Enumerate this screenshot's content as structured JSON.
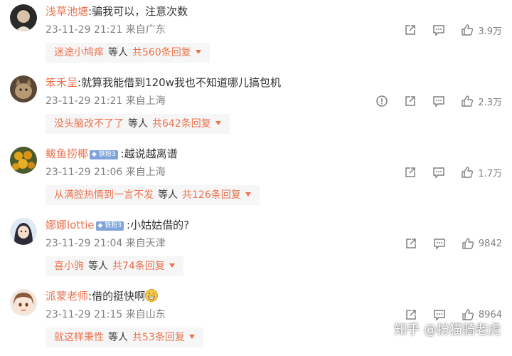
{
  "colors": {
    "accent": "#eb7350",
    "meta": "#808080",
    "text": "#333333",
    "reply_bg": "#f6f6f6",
    "badge": "#7fa4dc"
  },
  "comments": [
    {
      "user": "浅草池塘",
      "badge": "",
      "text": ":骗我可以，注意次数",
      "time": "23-11-29 21:21",
      "location": "来自广东",
      "likes": "3.9万",
      "has_report": false,
      "reply_user": "迷途小鸠痒",
      "reply_etc": "等人",
      "reply_total": "共560条回复"
    },
    {
      "user": "笨禾呈",
      "badge": "",
      "text": ":就算我能借到120w我也不知道哪儿搞包机",
      "time": "23-11-29 21:21",
      "location": "来自上海",
      "likes": "2.3万",
      "has_report": true,
      "reply_user": "没头脑改不了了",
      "reply_etc": "等人",
      "reply_total": "共642条回复"
    },
    {
      "user": "鲅鱼捞椰",
      "badge": "铁粉3",
      "text": ":越说越离谱",
      "time": "23-11-29 21:06",
      "location": "来自上海",
      "likes": "1.7万",
      "has_report": false,
      "reply_user": "从满腔热情到一言不发",
      "reply_etc": "等人",
      "reply_total": "共126条回复"
    },
    {
      "user": "娜娜lottie",
      "badge": "铁粉3",
      "text": ":小姑姑借的?",
      "time": "23-11-29 21:04",
      "location": "来自天津",
      "likes": "9842",
      "has_report": false,
      "reply_user": "喜小驹",
      "reply_etc": "等人",
      "reply_total": "共74条回复"
    },
    {
      "user": "派蒙老师",
      "badge": "",
      "text": ":借的挺快啊",
      "time": "23-11-29 21:15",
      "location": "来自山东",
      "likes": "8964",
      "has_report": false,
      "reply_user": "就这样秉性",
      "reply_etc": "等人",
      "reply_total": "共53条回复"
    }
  ],
  "watermark": "知乎 @扮猫骑老虎"
}
